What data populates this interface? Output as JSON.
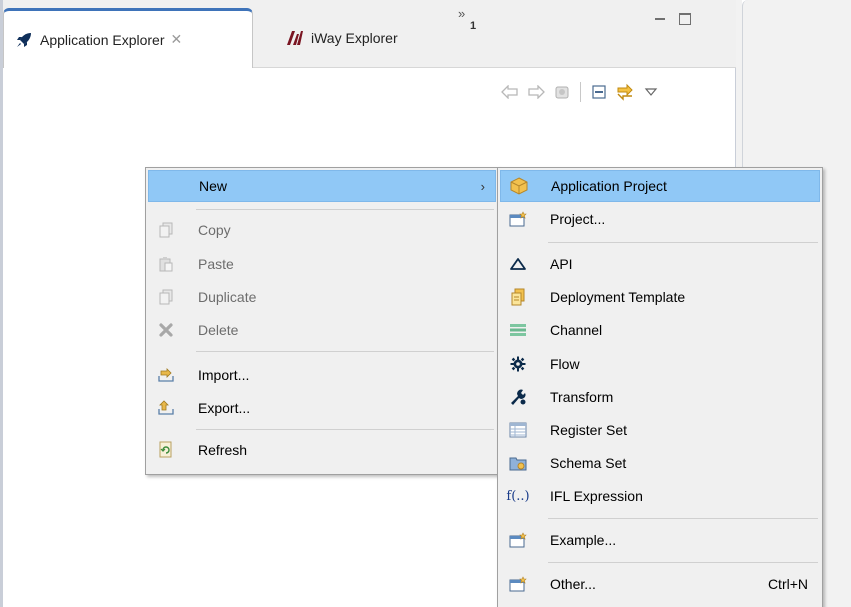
{
  "tabs": {
    "application_explorer": {
      "label": "Application Explorer",
      "icon": "rocket-icon",
      "close": "✕"
    },
    "iway_explorer": {
      "label": "iWay Explorer",
      "icon": "iway-logo-icon"
    },
    "overflow": {
      "glyph": "»",
      "count": "1"
    }
  },
  "toolbar": {
    "icons": [
      "back-arrow-icon",
      "forward-arrow-icon",
      "home-icon",
      "collapse-all-icon",
      "link-with-editor-icon",
      "view-menu-icon"
    ]
  },
  "context_menu": {
    "new": {
      "label": "New",
      "arrow": "›"
    },
    "copy": {
      "label": "Copy"
    },
    "paste": {
      "label": "Paste"
    },
    "duplicate": {
      "label": "Duplicate"
    },
    "delete": {
      "label": "Delete"
    },
    "import": {
      "label": "Import..."
    },
    "export": {
      "label": "Export..."
    },
    "refresh": {
      "label": "Refresh"
    }
  },
  "submenu": {
    "application_project": {
      "label": "Application Project"
    },
    "project": {
      "label": "Project..."
    },
    "api": {
      "label": "API"
    },
    "deployment_template": {
      "label": "Deployment Template"
    },
    "channel": {
      "label": "Channel"
    },
    "flow": {
      "label": "Flow"
    },
    "transform": {
      "label": "Transform"
    },
    "register_set": {
      "label": "Register Set"
    },
    "schema_set": {
      "label": "Schema Set"
    },
    "ifl_expression": {
      "label": "IFL Expression",
      "icon_text": "f(..)"
    },
    "example": {
      "label": "Example..."
    },
    "other": {
      "label": "Other...",
      "shortcut": "Ctrl+N"
    }
  },
  "colors": {
    "highlight": "#90c8f6",
    "tab_accent": "#3e73b9",
    "menu_bg": "#f0f0f0"
  }
}
